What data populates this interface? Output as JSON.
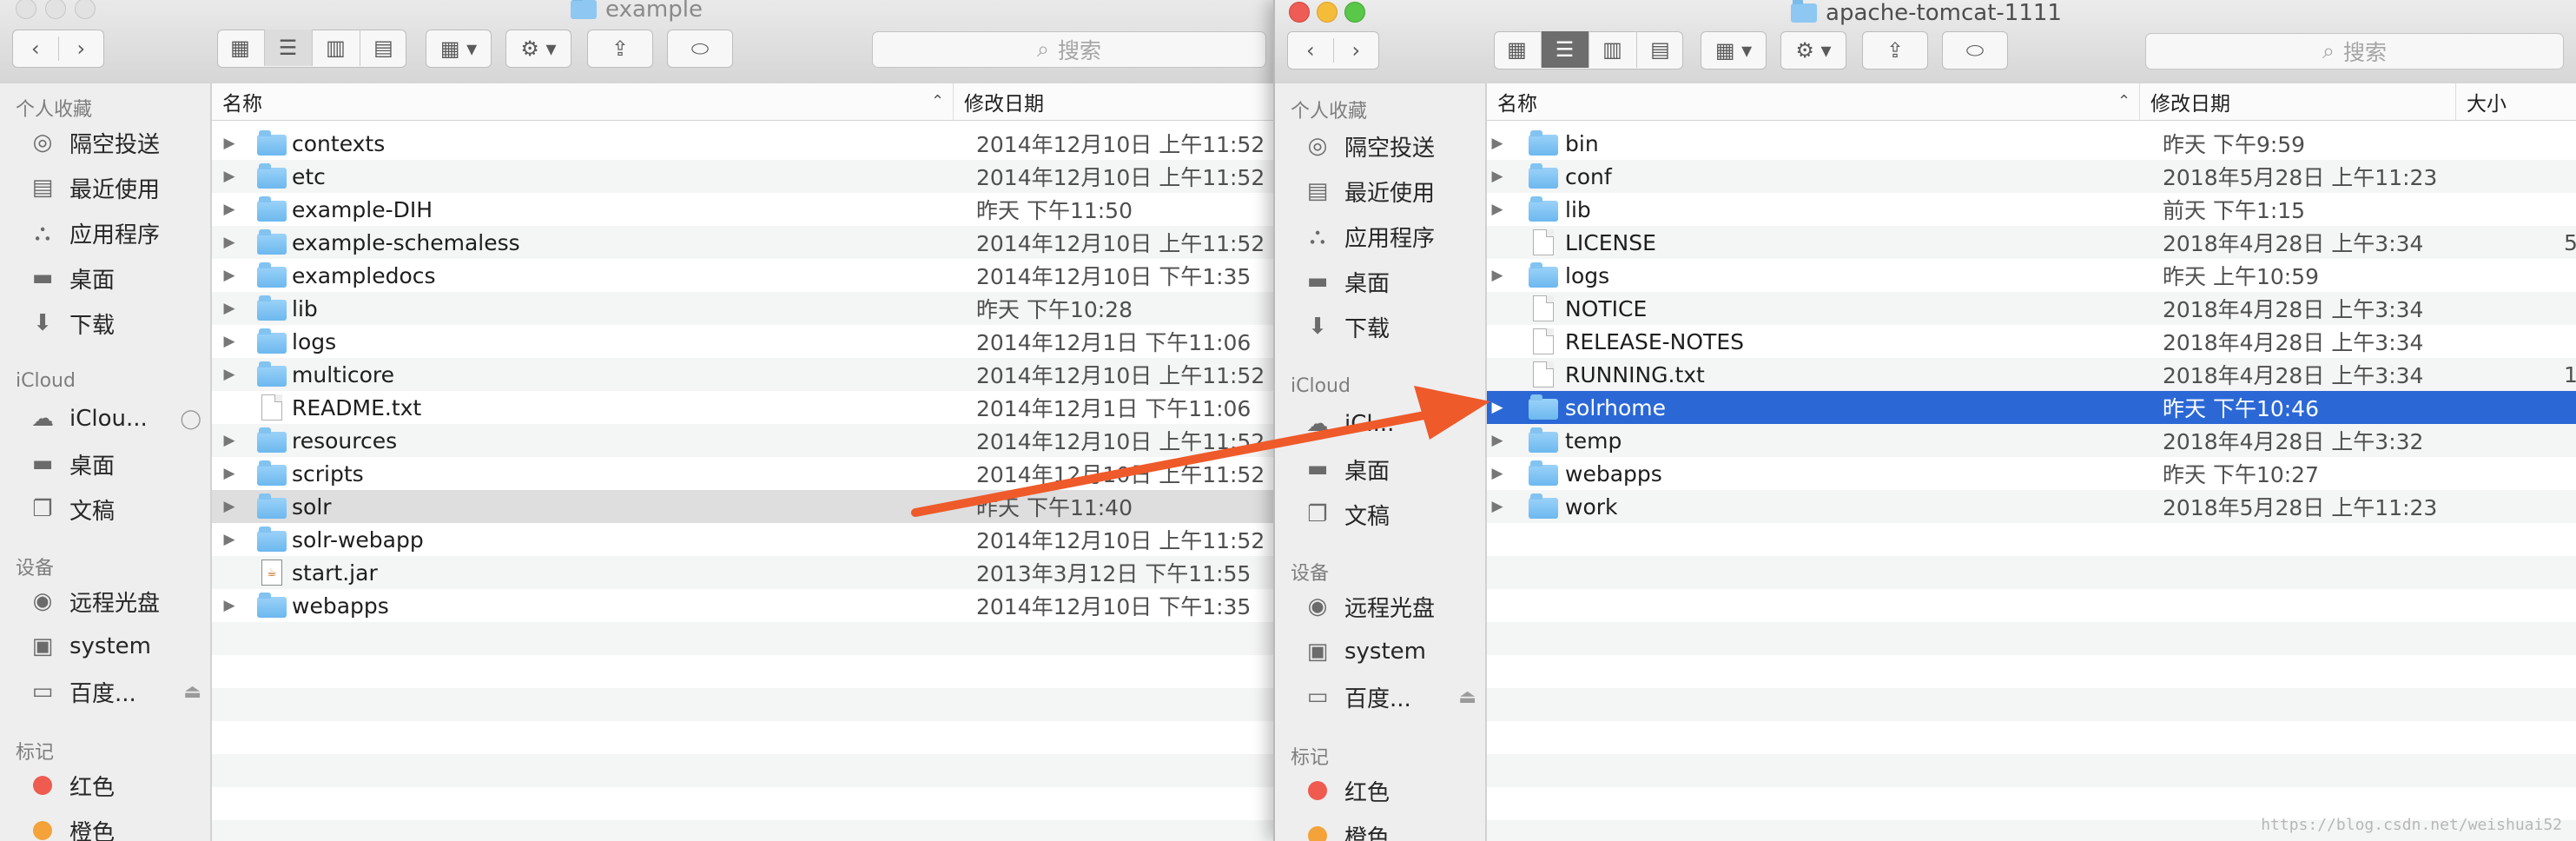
{
  "colors": {
    "accent": "#2b68d6",
    "arrow": "#ee5a2a"
  },
  "left_window": {
    "title": "example",
    "search_placeholder": "搜索",
    "sidebar": {
      "favorites_heading": "个人收藏",
      "favorites": [
        {
          "label": "隔空投送",
          "icon": "airdrop-icon"
        },
        {
          "label": "最近使用",
          "icon": "recents-icon"
        },
        {
          "label": "应用程序",
          "icon": "applications-icon"
        },
        {
          "label": "桌面",
          "icon": "desktop-icon"
        },
        {
          "label": "下载",
          "icon": "downloads-icon"
        }
      ],
      "icloud_heading": "iCloud",
      "icloud": [
        {
          "label": "iClou...",
          "icon": "icloud-icon"
        },
        {
          "label": "桌面",
          "icon": "desktop-icon"
        },
        {
          "label": "文稿",
          "icon": "documents-icon"
        }
      ],
      "devices_heading": "设备",
      "devices": [
        {
          "label": "远程光盘",
          "icon": "disc-icon"
        },
        {
          "label": "system",
          "icon": "disk-icon"
        },
        {
          "label": "百度...",
          "icon": "drive-icon"
        }
      ],
      "tags_heading": "标记",
      "tags": [
        {
          "label": "红色",
          "color": "#ef5b4f"
        },
        {
          "label": "橙色",
          "color": "#f3a33a"
        }
      ]
    },
    "columns": {
      "name": "名称",
      "date": "修改日期"
    },
    "files": [
      {
        "name": "contexts",
        "date": "2014年12月10日 上午11:52",
        "type": "folder"
      },
      {
        "name": "etc",
        "date": "2014年12月10日 上午11:52",
        "type": "folder"
      },
      {
        "name": "example-DIH",
        "date": "昨天 下午11:50",
        "type": "folder"
      },
      {
        "name": "example-schemaless",
        "date": "2014年12月10日 上午11:52",
        "type": "folder"
      },
      {
        "name": "exampledocs",
        "date": "2014年12月10日 下午1:35",
        "type": "folder"
      },
      {
        "name": "lib",
        "date": "昨天 下午10:28",
        "type": "folder"
      },
      {
        "name": "logs",
        "date": "2014年12月1日 下午11:06",
        "type": "folder"
      },
      {
        "name": "multicore",
        "date": "2014年12月10日 上午11:52",
        "type": "folder"
      },
      {
        "name": "README.txt",
        "date": "2014年12月1日 下午11:06",
        "type": "file"
      },
      {
        "name": "resources",
        "date": "2014年12月10日 上午11:52",
        "type": "folder"
      },
      {
        "name": "scripts",
        "date": "2014年12月10日 上午11:52",
        "type": "folder"
      },
      {
        "name": "solr",
        "date": "昨天 下午11:40",
        "type": "folder",
        "highlight": true
      },
      {
        "name": "solr-webapp",
        "date": "2014年12月10日 上午11:52",
        "type": "folder"
      },
      {
        "name": "start.jar",
        "date": "2013年3月12日 下午11:55",
        "type": "jar"
      },
      {
        "name": "webapps",
        "date": "2014年12月10日 下午1:35",
        "type": "folder"
      }
    ]
  },
  "right_window": {
    "title": "apache-tomcat-1111",
    "search_placeholder": "搜索",
    "sidebar": {
      "favorites_heading": "个人收藏",
      "favorites": [
        {
          "label": "隔空投送",
          "icon": "airdrop-icon"
        },
        {
          "label": "最近使用",
          "icon": "recents-icon"
        },
        {
          "label": "应用程序",
          "icon": "applications-icon"
        },
        {
          "label": "桌面",
          "icon": "desktop-icon"
        },
        {
          "label": "下载",
          "icon": "downloads-icon"
        }
      ],
      "icloud_heading": "iCloud",
      "icloud": [
        {
          "label": "iCl...",
          "icon": "icloud-icon"
        },
        {
          "label": "桌面",
          "icon": "desktop-icon"
        },
        {
          "label": "文稿",
          "icon": "documents-icon"
        }
      ],
      "devices_heading": "设备",
      "devices": [
        {
          "label": "远程光盘",
          "icon": "disc-icon"
        },
        {
          "label": "system",
          "icon": "disk-icon"
        },
        {
          "label": "百度...",
          "icon": "drive-icon"
        }
      ],
      "tags_heading": "标记",
      "tags": [
        {
          "label": "红色",
          "color": "#ef5b4f"
        },
        {
          "label": "橙色",
          "color": "#f3a33a"
        }
      ]
    },
    "columns": {
      "name": "名称",
      "date": "修改日期",
      "size": "大小"
    },
    "files": [
      {
        "name": "bin",
        "date": "昨天 下午9:59",
        "type": "folder"
      },
      {
        "name": "conf",
        "date": "2018年5月28日 上午11:23",
        "type": "folder"
      },
      {
        "name": "lib",
        "date": "前天 下午1:15",
        "type": "folder"
      },
      {
        "name": "LICENSE",
        "date": "2018年4月28日 上午3:34",
        "type": "file",
        "size": "5"
      },
      {
        "name": "logs",
        "date": "昨天 上午10:59",
        "type": "folder"
      },
      {
        "name": "NOTICE",
        "date": "2018年4月28日 上午3:34",
        "type": "file"
      },
      {
        "name": "RELEASE-NOTES",
        "date": "2018年4月28日 上午3:34",
        "type": "file"
      },
      {
        "name": "RUNNING.txt",
        "date": "2018年4月28日 上午3:34",
        "type": "file",
        "size": "1"
      },
      {
        "name": "solrhome",
        "date": "昨天 下午10:46",
        "type": "folder",
        "selected": true
      },
      {
        "name": "temp",
        "date": "2018年4月28日 上午3:32",
        "type": "folder"
      },
      {
        "name": "webapps",
        "date": "昨天 下午10:27",
        "type": "folder"
      },
      {
        "name": "work",
        "date": "2018年5月28日 上午11:23",
        "type": "folder"
      }
    ]
  },
  "watermark": "https://blog.csdn.net/weishuai52"
}
